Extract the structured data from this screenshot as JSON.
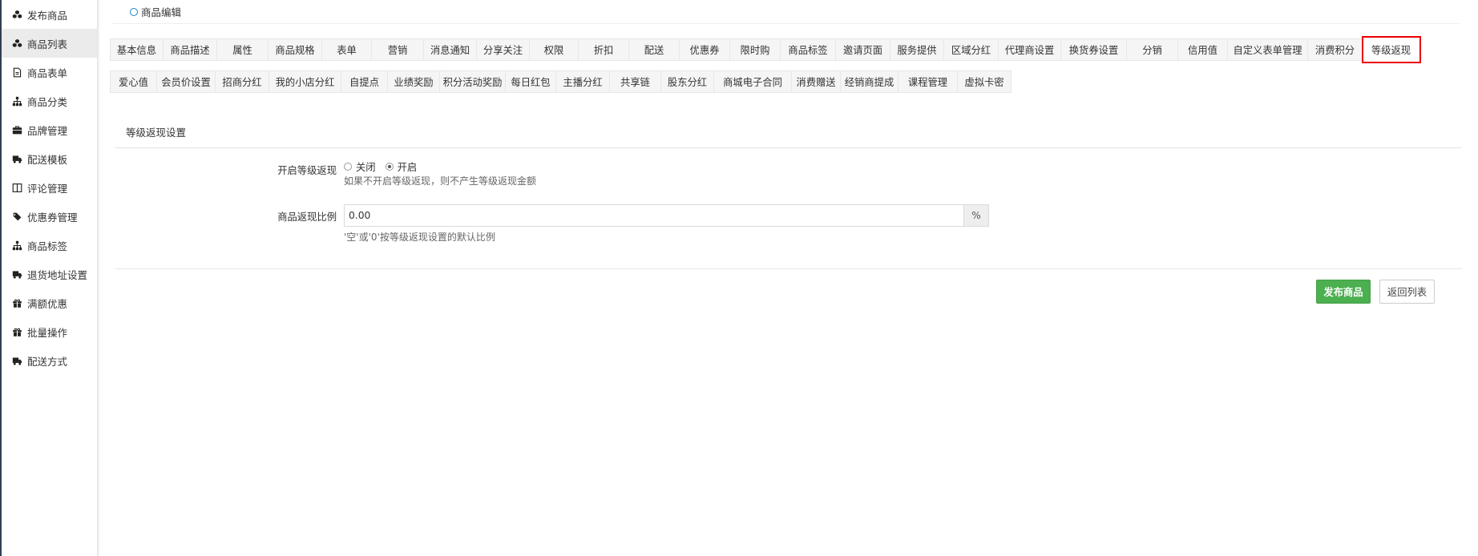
{
  "sidebar": {
    "items": [
      {
        "label": "发布商品",
        "icon": "cubes-icon",
        "active": false
      },
      {
        "label": "商品列表",
        "icon": "cubes-icon",
        "active": true
      },
      {
        "label": "商品表单",
        "icon": "file-icon",
        "active": false
      },
      {
        "label": "商品分类",
        "icon": "sitemap-icon",
        "active": false
      },
      {
        "label": "品牌管理",
        "icon": "briefcase-icon",
        "active": false
      },
      {
        "label": "配送模板",
        "icon": "truck-icon",
        "active": false
      },
      {
        "label": "评论管理",
        "icon": "columns-icon",
        "active": false
      },
      {
        "label": "优惠券管理",
        "icon": "tags-icon",
        "active": false
      },
      {
        "label": "商品标签",
        "icon": "sitemap-icon",
        "active": false
      },
      {
        "label": "退货地址设置",
        "icon": "truck-icon",
        "active": false
      },
      {
        "label": "满额优惠",
        "icon": "gift-icon",
        "active": false
      },
      {
        "label": "批量操作",
        "icon": "gift-icon",
        "active": false
      },
      {
        "label": "配送方式",
        "icon": "truck-icon",
        "active": false
      }
    ]
  },
  "header": {
    "title": "商品编辑"
  },
  "tabs": {
    "row1": [
      "基本信息",
      "商品描述",
      "属性",
      "商品规格",
      "表单",
      "营销",
      "消息通知",
      "分享关注",
      "权限",
      "折扣",
      "配送",
      "优惠券",
      "限时购",
      "商品标签",
      "邀请页面",
      "服务提供",
      "区域分红",
      "代理商设置",
      "换货券设置",
      "分销",
      "信用值",
      "自定义表单管理",
      "消费积分",
      "等级返现"
    ],
    "row2": [
      "爱心值",
      "会员价设置",
      "招商分红",
      "我的小店分红",
      "自提点",
      "业绩奖励",
      "积分活动奖励",
      "每日红包",
      "主播分红",
      "共享链",
      "股东分红",
      "商城电子合同",
      "消费赠送",
      "经销商提成",
      "课程管理",
      "虚拟卡密"
    ],
    "active": "等级返现"
  },
  "section": {
    "title": "等级返现设置",
    "enable_label": "开启等级返现",
    "radio_off": "关闭",
    "radio_on": "开启",
    "selected": "开启",
    "enable_help": "如果不开启等级返现，则不产生等级返现金额",
    "ratio_label": "商品返现比例",
    "ratio_value": "0.00",
    "ratio_unit": "%",
    "ratio_help": "'空'或'0'按等级返现设置的默认比例"
  },
  "actions": {
    "publish": "发布商品",
    "back": "返回列表"
  },
  "colors": {
    "primary": "#4caf50",
    "highlight": "#e00000",
    "accent": "#1c84c6"
  }
}
